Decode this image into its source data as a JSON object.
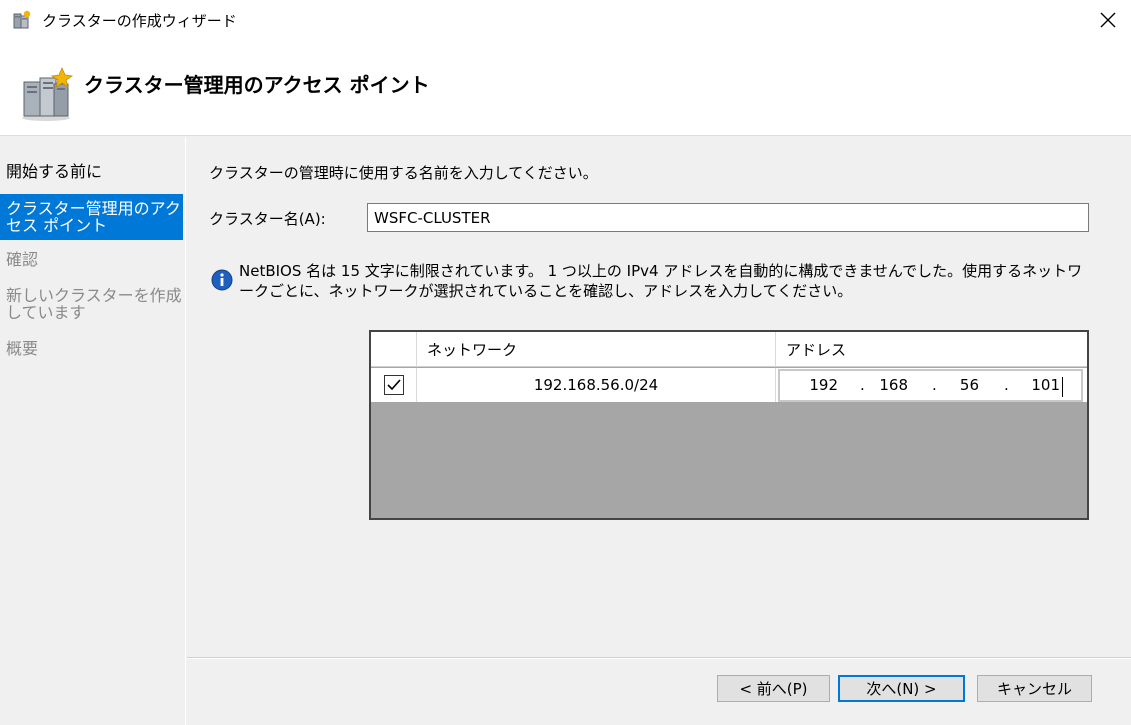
{
  "window": {
    "title": "クラスターの作成ウィザード"
  },
  "header": {
    "title": "クラスター管理用のアクセス ポイント"
  },
  "sidebar": {
    "items": [
      {
        "label": "開始する前に",
        "state": "done"
      },
      {
        "label": "クラスター管理用のアクセス ポイント",
        "state": "active"
      },
      {
        "label": "確認",
        "state": "pending"
      },
      {
        "label": "新しいクラスターを作成しています",
        "state": "pending"
      },
      {
        "label": "概要",
        "state": "pending"
      }
    ]
  },
  "main": {
    "instruction": "クラスターの管理時に使用する名前を入力してください。",
    "cluster_name_label": "クラスター名(A):",
    "cluster_name_value": "WSFC-CLUSTER",
    "info_text": "NetBIOS 名は 15 文字に制限されています。 1 つ以上の IPv4 アドレスを自動的に構成できませんでした。使用するネットワークごとに、ネットワークが選択されていることを確認し、アドレスを入力してください。",
    "table": {
      "columns": [
        "ネットワーク",
        "アドレス"
      ],
      "rows": [
        {
          "checked": true,
          "network": "192.168.56.0/24",
          "address": [
            "192",
            "168",
            "56",
            "101"
          ]
        }
      ]
    }
  },
  "footer": {
    "back_label": "< 前へ(P)",
    "next_label": "次へ(N) >",
    "cancel_label": "キャンセル"
  },
  "colors": {
    "accent": "#0078d7",
    "grid_empty": "#a6a6a6"
  },
  "icons": {
    "app": "cluster-wizard-icon",
    "header": "cluster-server-icon",
    "info": "info-icon",
    "close": "close-icon"
  }
}
